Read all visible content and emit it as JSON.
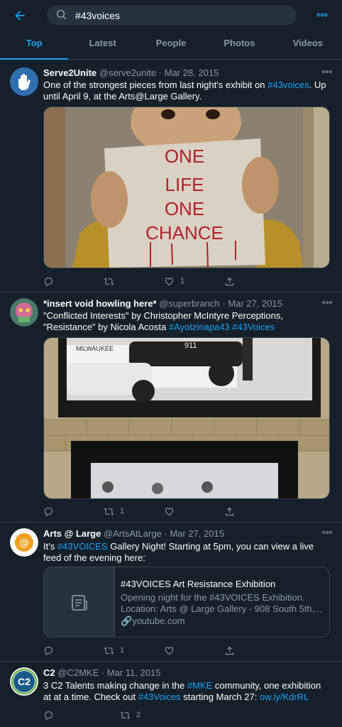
{
  "search": {
    "query": "#43voices"
  },
  "tabs": [
    "Top",
    "Latest",
    "People",
    "Photos",
    "Videos"
  ],
  "tweets": [
    {
      "name": "Serve2Unite",
      "meta": "@serve2unite · Mar 28, 2015",
      "text_parts": [
        "One of the strongest pieces from last night's exhibit on ",
        "#43voices",
        ". Up until April 9, at the Arts@Large Gallery."
      ],
      "image_sign": [
        "ONE",
        "LIFE",
        "ONE",
        "CHANCE"
      ],
      "likes": "1"
    },
    {
      "name": "*insert void howling here*",
      "meta": "@superbranch · Mar 27, 2015",
      "text_parts": [
        "\"Conflicted Interests\" by Christopher McIntyre Perceptions, \"Resistance\" by Nicola Acosta ",
        "#Ayotzinapa43",
        " ",
        "#43Voices"
      ],
      "image_labels": [
        "MILWAUKEE",
        "911"
      ],
      "retweets": "1"
    },
    {
      "name": "Arts @ Large",
      "meta": "@ArtsAtLarge · Mar 27, 2015",
      "text_parts": [
        "It's ",
        "#43VOICES",
        " Gallery Night! Starting at 5pm, you can view a live feed of the evening here:"
      ],
      "card": {
        "title": "#43VOICES Art Resistance Exhibition",
        "desc": "Opening night for the #43VOICES Exhibition. Location: Arts @ Large Gallery - 908 South 5th,...",
        "domain": "youtube.com"
      },
      "retweets": "1"
    },
    {
      "name": "C2",
      "meta": "@C2MKE · Mar 11, 2015",
      "avatar_text": "C2",
      "text_parts": [
        "3 C2 Talents making change in the ",
        "#MKE",
        " community, one exhibition at at a time. Check out ",
        "#43Voices",
        " starting March 27: ",
        "ow.ly/KdrRL"
      ],
      "retweets": "2"
    }
  ]
}
